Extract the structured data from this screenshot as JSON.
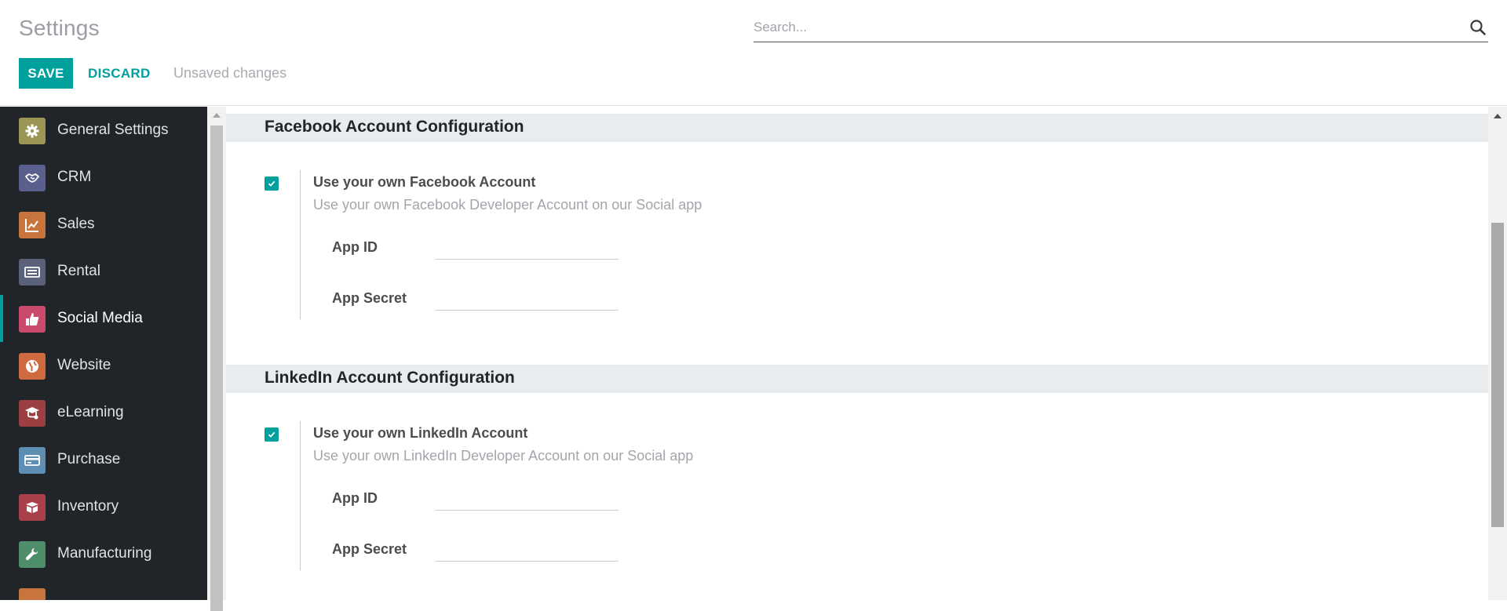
{
  "header": {
    "title": "Settings",
    "search_placeholder": "Search...",
    "save_label": "SAVE",
    "discard_label": "DISCARD",
    "status": "Unsaved changes"
  },
  "colors": {
    "accent": "#00a09d",
    "sidebar_bg": "#212529",
    "section_bg": "#e9ecef"
  },
  "sidebar": {
    "items": [
      {
        "label": "General Settings",
        "icon": "gear-icon",
        "color": "#9b9556"
      },
      {
        "label": "CRM",
        "icon": "handshake-icon",
        "color": "#5b5f8d"
      },
      {
        "label": "Sales",
        "icon": "chart-line-icon",
        "color": "#c7753c"
      },
      {
        "label": "Rental",
        "icon": "keyboard-icon",
        "color": "#5c617a"
      },
      {
        "label": "Social Media",
        "icon": "thumbs-up-icon",
        "color": "#c94a6b",
        "active": true
      },
      {
        "label": "Website",
        "icon": "globe-icon",
        "color": "#cf6a3f"
      },
      {
        "label": "eLearning",
        "icon": "graduation-icon",
        "color": "#9c3f43"
      },
      {
        "label": "Purchase",
        "icon": "credit-card-icon",
        "color": "#5e8fb3"
      },
      {
        "label": "Inventory",
        "icon": "box-icon",
        "color": "#a8414a"
      },
      {
        "label": "Manufacturing",
        "icon": "wrench-icon",
        "color": "#4f8e6b"
      }
    ]
  },
  "sections": [
    {
      "title": "Facebook Account Configuration",
      "setting_title": "Use your own Facebook Account",
      "setting_desc": "Use your own Facebook Developer Account on our Social app",
      "checked": true,
      "fields": [
        {
          "label": "App ID",
          "value": ""
        },
        {
          "label": "App Secret",
          "value": ""
        }
      ]
    },
    {
      "title": "LinkedIn Account Configuration",
      "setting_title": "Use your own LinkedIn Account",
      "setting_desc": "Use your own LinkedIn Developer Account on our Social app",
      "checked": true,
      "fields": [
        {
          "label": "App ID",
          "value": ""
        },
        {
          "label": "App Secret",
          "value": ""
        }
      ]
    }
  ]
}
